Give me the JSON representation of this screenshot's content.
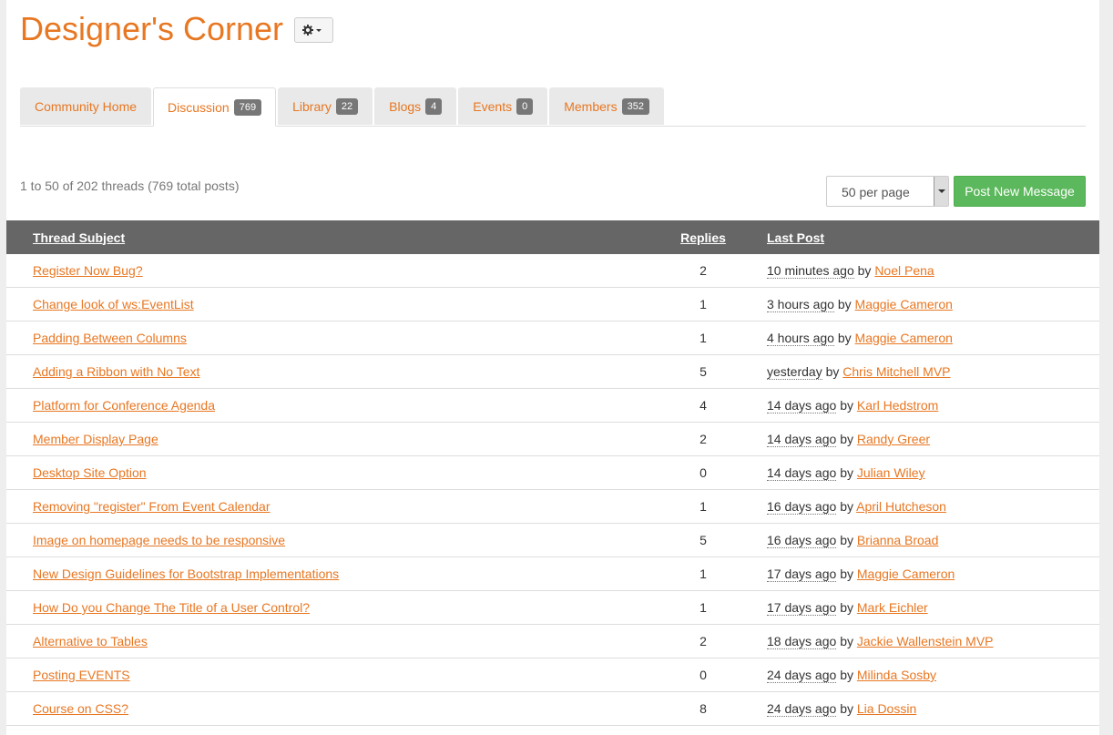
{
  "header": {
    "title": "Designer's Corner"
  },
  "tabs": [
    {
      "label": "Community Home",
      "count": null
    },
    {
      "label": "Discussion",
      "count": "769"
    },
    {
      "label": "Library",
      "count": "22"
    },
    {
      "label": "Blogs",
      "count": "4"
    },
    {
      "label": "Events",
      "count": "0"
    },
    {
      "label": "Members",
      "count": "352"
    }
  ],
  "toolbar": {
    "summary": "1 to 50 of 202 threads (769 total posts)",
    "per_page": "50 per page",
    "post_button": "Post New Message"
  },
  "table": {
    "headers": {
      "subject": "Thread Subject",
      "replies": "Replies",
      "last_post": "Last Post"
    },
    "by_label": "by",
    "rows": [
      {
        "subject": "Register Now Bug?",
        "replies": "2",
        "time": "10 minutes ago",
        "author": "Noel Pena"
      },
      {
        "subject": "Change look of ws:EventList",
        "replies": "1",
        "time": "3 hours ago",
        "author": "Maggie Cameron"
      },
      {
        "subject": "Padding Between Columns",
        "replies": "1",
        "time": "4 hours ago",
        "author": "Maggie Cameron"
      },
      {
        "subject": "Adding a Ribbon with No Text",
        "replies": "5",
        "time": "yesterday",
        "author": "Chris Mitchell MVP"
      },
      {
        "subject": "Platform for Conference Agenda",
        "replies": "4",
        "time": "14 days ago",
        "author": "Karl Hedstrom"
      },
      {
        "subject": "Member Display Page",
        "replies": "2",
        "time": "14 days ago",
        "author": "Randy Greer"
      },
      {
        "subject": "Desktop Site Option",
        "replies": "0",
        "time": "14 days ago",
        "author": "Julian Wiley"
      },
      {
        "subject": "Removing \"register\" From Event Calendar",
        "replies": "1",
        "time": "16 days ago",
        "author": "April Hutcheson"
      },
      {
        "subject": "Image on homepage needs to be responsive",
        "replies": "5",
        "time": "16 days ago",
        "author": "Brianna Broad"
      },
      {
        "subject": "New Design Guidelines for Bootstrap Implementations",
        "replies": "1",
        "time": "17 days ago",
        "author": "Maggie Cameron"
      },
      {
        "subject": "How Do you Change The Title of a User Control?",
        "replies": "1",
        "time": "17 days ago",
        "author": "Mark Eichler"
      },
      {
        "subject": "Alternative to Tables",
        "replies": "2",
        "time": "18 days ago",
        "author": "Jackie Wallenstein MVP"
      },
      {
        "subject": "Posting EVENTS",
        "replies": "0",
        "time": "24 days ago",
        "author": "Milinda Sosby"
      },
      {
        "subject": "Course on CSS?",
        "replies": "8",
        "time": "24 days ago",
        "author": "Lia Dossin"
      }
    ]
  },
  "colors": {
    "accent": "#e87722",
    "header_bg": "#666666",
    "button_green": "#5cb85c"
  },
  "icons": {
    "settings": "gear-icon",
    "dropdown": "chevron-down-icon"
  }
}
